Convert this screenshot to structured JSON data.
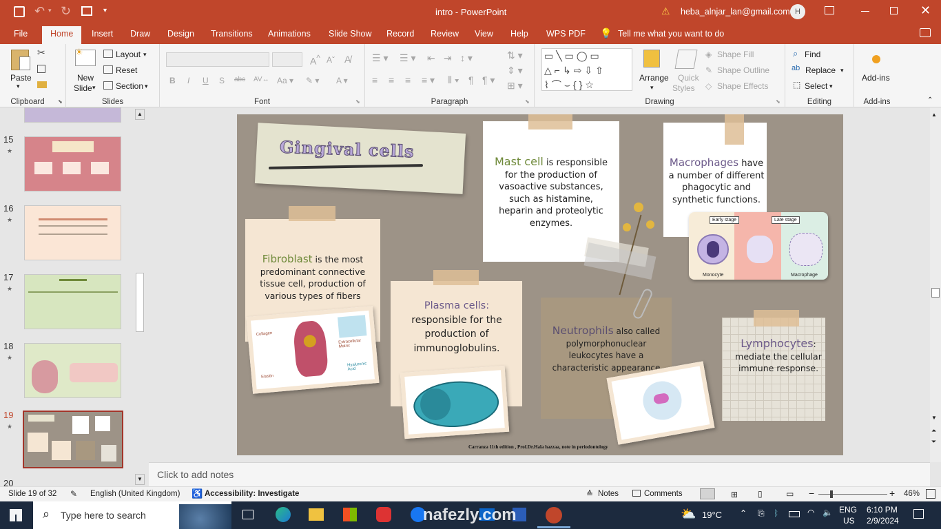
{
  "titlebar": {
    "doc_title": "intro  -  PowerPoint",
    "account": "heba_alnjar_lan@gmail.com",
    "avatar_initial": "H"
  },
  "tabs": [
    "File",
    "Home",
    "Insert",
    "Draw",
    "Design",
    "Transitions",
    "Animations",
    "Slide Show",
    "Record",
    "Review",
    "View",
    "Help",
    "WPS PDF"
  ],
  "tell_me": "Tell me what you want to do",
  "ribbon": {
    "clipboard": {
      "paste": "Paste",
      "label": "Clipboard"
    },
    "slides": {
      "new_slide_1": "New",
      "new_slide_2": "Slide",
      "layout": "Layout",
      "reset": "Reset",
      "section": "Section",
      "label": "Slides"
    },
    "font": {
      "label": "Font"
    },
    "paragraph": {
      "label": "Paragraph"
    },
    "drawing": {
      "arrange": "Arrange",
      "quick_1": "Quick",
      "quick_2": "Styles",
      "shape_fill": "Shape Fill",
      "shape_outline": "Shape Outline",
      "shape_effects": "Shape Effects",
      "label": "Drawing"
    },
    "editing": {
      "find": "Find",
      "replace": "Replace",
      "select": "Select",
      "label": "Editing"
    },
    "addins": {
      "addins": "Add-ins",
      "label": "Add-ins"
    }
  },
  "thumbnails": [
    {
      "num": "15",
      "bg": "#d6848a"
    },
    {
      "num": "16",
      "bg": "#fbe6d6"
    },
    {
      "num": "17",
      "bg": "#d7e6bf"
    },
    {
      "num": "18",
      "bg": "#dfe9c8"
    },
    {
      "num": "19",
      "bg": "#9d9387"
    },
    {
      "num": "20",
      "bg": "#e6e6e6"
    }
  ],
  "slide": {
    "title": "Gingival cells",
    "fibroblast": {
      "term": "Fibroblast",
      "text": " is the most predominant connective tissue cell, production of various types of fibers"
    },
    "fibro_img": {
      "a": "Collagen",
      "b": "Extracellular Matrix",
      "c": "Elastin",
      "d": "Hyaluronic Acid"
    },
    "mast": {
      "term": "Mast cell",
      "text": " is responsible for the production of vasoactive substances, such as histamine, heparin and proteolytic enzymes."
    },
    "macro": {
      "term": "Macrophages",
      "text": " have a number of different phagocytic and synthetic functions."
    },
    "macro_img": {
      "early": "Early stage",
      "late": "Late stage",
      "mono": "Monocyte",
      "macro": "Macrophage"
    },
    "plasma": {
      "term": "Plasma cells:",
      "text": "responsible for the production of immunoglobulins."
    },
    "neutro": {
      "term": "Neutrophils",
      "text": " also called polymorphonuclear leukocytes have a characteristic appearance"
    },
    "lympho": {
      "term": "Lymphocytes",
      "text": ": mediate the cellular immune response."
    },
    "citation": "Carranza 11th edition , Prof.Dr.Hala hazzaa, note in periodontology"
  },
  "notes_placeholder": "Click to add notes",
  "status": {
    "slide_of": "Slide 19 of 32",
    "language": "English (United Kingdom)",
    "accessibility": "Accessibility: Investigate",
    "notes": "Notes",
    "comments": "Comments",
    "zoom": "46%"
  },
  "taskbar": {
    "search": "Type here to search",
    "weather": "19°C",
    "lang1": "ENG",
    "lang2": "US",
    "time": "6:10 PM",
    "date": "2/9/2024"
  },
  "watermark": "nafezly.com",
  "colors": {
    "accent": "#c0462b",
    "slide_bg": "#9d9387",
    "term_green": "#6f8a3a",
    "term_purple": "#6c5a8a"
  }
}
